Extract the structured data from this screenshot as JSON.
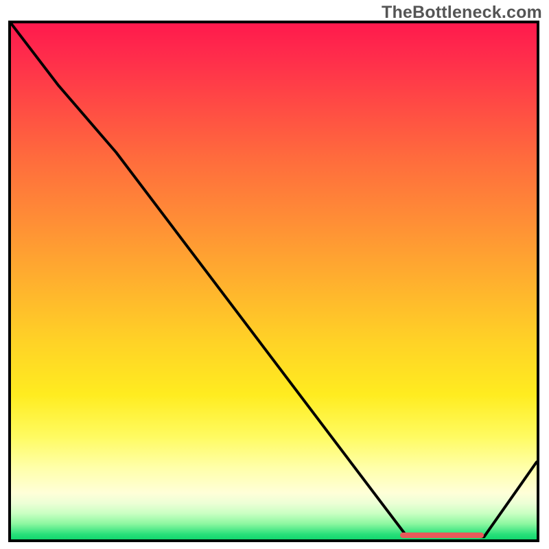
{
  "watermark": "TheBottleneck.com",
  "colors": {
    "border": "#000000",
    "curve": "#000000",
    "highlight": "#e85a5a",
    "watermark_text": "#555555"
  },
  "chart_data": {
    "type": "line",
    "title": "",
    "xlabel": "",
    "ylabel": "",
    "xlim": [
      0,
      100
    ],
    "ylim": [
      0,
      100
    ],
    "x": [
      0,
      9,
      20,
      75,
      90,
      100
    ],
    "values": [
      100,
      88,
      75,
      1,
      0.5,
      15
    ],
    "highlight_range": {
      "x_start": 74,
      "x_end": 90,
      "y": 0.8
    },
    "annotations": [
      "TheBottleneck.com"
    ],
    "background_gradient": "red-orange-yellow-pale-green (top to bottom)"
  }
}
